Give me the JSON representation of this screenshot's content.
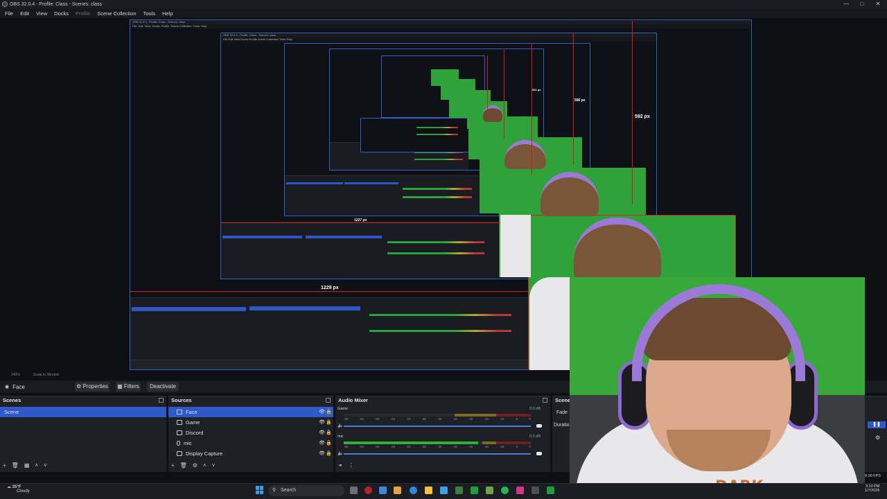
{
  "window": {
    "title": "OBS 32.0.4 - Profile: Class - Scenes: class"
  },
  "menu": [
    "File",
    "Edit",
    "View",
    "Docks",
    "Profile",
    "Scene Collection",
    "Tools",
    "Help"
  ],
  "preview": {
    "measures": [
      "592 px",
      "1229 px",
      "1227 px",
      "596 px",
      "591 px"
    ],
    "inner_status": "140%",
    "inner_scale": "Scale to Window"
  },
  "status": {
    "zoom": "140%",
    "scale": "Scale to Window"
  },
  "context": {
    "source": "Face",
    "properties": "Properties",
    "filters": "Filters",
    "deactivate": "Deactivate"
  },
  "scenes": {
    "title": "Scenes",
    "items": [
      "Scene"
    ]
  },
  "sources": {
    "title": "Sources",
    "items": [
      "Face",
      "Game",
      "Discord",
      "mic",
      "Display Capture"
    ]
  },
  "mixer": {
    "title": "Audio Mixer",
    "tracks": [
      {
        "name": "Game",
        "db": "0.0 dB",
        "level": 0.0
      },
      {
        "name": "mic",
        "db": "0.0 dB",
        "level": 0.72
      }
    ],
    "scale": [
      "-60",
      "-55",
      "-50",
      "-45",
      "-40",
      "-35",
      "-30",
      "-25",
      "-20",
      "-15",
      "-10",
      "-5",
      "0"
    ]
  },
  "transitions": {
    "title": "Scene",
    "fade": "Fade",
    "duration": "Duration"
  },
  "stats": {
    "fps": "0.00 FPS"
  },
  "taskbar": {
    "weather_temp": "35°F",
    "weather_desc": "Cloudy",
    "search": "Search",
    "time": "3:10 PM",
    "date": "1/7/2026"
  },
  "webcam": {
    "shirt_text": "DARK"
  },
  "colors": {
    "selection": "#2e59c8",
    "chroma": "#2fa33a",
    "measure_line": "#d11c1c"
  }
}
